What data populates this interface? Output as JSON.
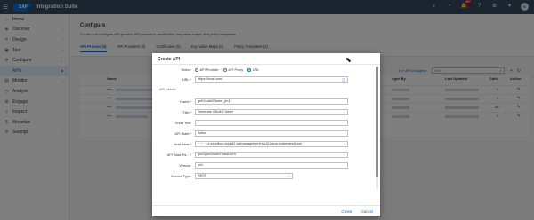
{
  "shell": {
    "app_name": "Integration Suite",
    "logo": "SAP",
    "notification_count": "99+",
    "avatar_initials": "",
    "icons": [
      "search-icon",
      "bell-icon",
      "notification-icon",
      "settings-icon",
      "help-icon",
      "avatar"
    ]
  },
  "sidebar": {
    "items": [
      {
        "label": "Home",
        "icon": "home-icon"
      },
      {
        "label": "Discover",
        "icon": "discover-icon"
      },
      {
        "label": "Design",
        "icon": "design-icon"
      },
      {
        "label": "Test",
        "icon": "test-icon"
      },
      {
        "label": "Configure",
        "icon": "configure-icon"
      },
      {
        "label": "APIs",
        "icon": ""
      },
      {
        "label": "Monitor",
        "icon": "monitor-icon"
      },
      {
        "label": "Analyze",
        "icon": "analyze-icon"
      },
      {
        "label": "Engage",
        "icon": "engage-icon"
      },
      {
        "label": "Inspect",
        "icon": "inspect-icon"
      },
      {
        "label": "Monetize",
        "icon": "monetize-icon"
      },
      {
        "label": "Settings",
        "icon": "settings-icon"
      }
    ]
  },
  "page": {
    "title": "Configure",
    "subtitle": "Create and configure API proxies, API providers, certificates, key value maps, and policy templates.",
    "tabs": [
      {
        "label": "API Proxies (4)",
        "active": true
      },
      {
        "label": "API Providers (0)",
        "active": false
      },
      {
        "label": "Certificates (0)",
        "active": false
      },
      {
        "label": "Key Value Maps (0)",
        "active": false
      },
      {
        "label": "Policy Templates (1)",
        "active": false
      }
    ],
    "toolbar": {
      "designer_link": "e in API Designer",
      "filter_placeholder": "Filter"
    },
    "table": {
      "columns": [
        "Name",
        "nged By",
        "Last Updated",
        "Calls",
        "Action"
      ],
      "calls": [
        "0",
        "0",
        "36",
        "0"
      ]
    }
  },
  "dialog": {
    "title": "Create API",
    "select_label": "Select:",
    "select_options": [
      "API Provider",
      "API Proxy",
      "URL"
    ],
    "selected_option": "URL",
    "url_label": "URL:",
    "url_value": "https://local.com/",
    "api_details_heading": "API Details",
    "name_label": "Name:",
    "name_value": "getOAuth2Token_jm1",
    "title_label": "Title:",
    "title_value": "Generate OAuth2 token",
    "short_text_label": "Short Text:",
    "short_text_value": "",
    "api_state_label": "API State:",
    "api_state_value": "Active",
    "host_alias_label": "Host Alias:",
    "host_alias_value": "········-s-sandbox-ocsbd2.apimanagement.eu10.hana.ondemand.com",
    "base_path_label": "API Base Pa...:",
    "base_path_value": "/jm1/getOAuth2TokenURI",
    "version_label": "Version:",
    "version_value": "jm1",
    "service_type_label": "Service Type:",
    "service_type_value": "REST",
    "create_button": "Create",
    "cancel_button": "Cancel"
  }
}
